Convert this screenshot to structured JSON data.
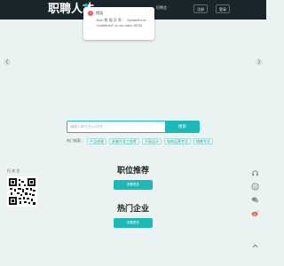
{
  "header": {
    "logo_text": "职聘人才",
    "logo_sub": "",
    "nav_link": "招聘会",
    "login_label": "注册",
    "register_label": "登录"
  },
  "toast": {
    "title": "错误",
    "message": "Json 数 据 异 常 ： SyntaxError: \"undefined\" is not valid JSON"
  },
  "search": {
    "placeholder": "请输入职位名/公司名",
    "button_label": "搜索"
  },
  "hot_search": {
    "label": "热门搜索：",
    "tags": [
      "产品经理",
      "前端开发工程师",
      "平面设计",
      "电商运营专员",
      "销售专员"
    ]
  },
  "sections": {
    "jobs_title": "职位推荐",
    "jobs_more": "查看更多",
    "companies_title": "热门企业",
    "companies_more": "查看更多"
  },
  "sidebar": {
    "qr_label": "扫 关 注"
  },
  "colors": {
    "header_bg": "#18252b",
    "accent": "#1cb9b6",
    "page_bg": "#eaf3f1",
    "error": "#e05a5a"
  },
  "icons": [
    "chevron-left-icon",
    "chevron-right-icon",
    "qr-code-icon",
    "headset-icon",
    "smile-icon",
    "wechat-icon",
    "weibo-icon",
    "arrow-up-icon"
  ]
}
